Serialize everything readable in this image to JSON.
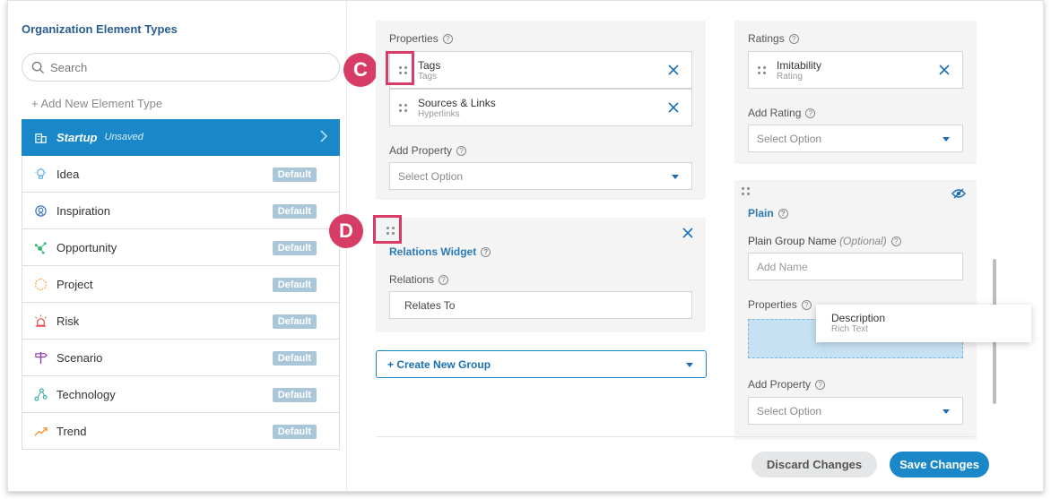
{
  "sidebar": {
    "title": "Organization Element Types",
    "search_placeholder": "Search",
    "add_label": "+ Add New Element Type",
    "active": {
      "label": "Startup",
      "status": "Unsaved"
    },
    "items": [
      {
        "label": "Idea",
        "badge": "Default",
        "icon": "lightbulb-icon",
        "color": "#5fb0e8"
      },
      {
        "label": "Inspiration",
        "badge": "Default",
        "icon": "inspiration-icon",
        "color": "#3a76c4"
      },
      {
        "label": "Opportunity",
        "badge": "Default",
        "icon": "opportunity-icon",
        "color": "#2eb86f"
      },
      {
        "label": "Project",
        "badge": "Default",
        "icon": "project-icon",
        "color": "#f2a33a"
      },
      {
        "label": "Risk",
        "badge": "Default",
        "icon": "alarm-icon",
        "color": "#e84848"
      },
      {
        "label": "Scenario",
        "badge": "Default",
        "icon": "signpost-icon",
        "color": "#8e3aa8"
      },
      {
        "label": "Technology",
        "badge": "Default",
        "icon": "network-icon",
        "color": "#28a8a0"
      },
      {
        "label": "Trend",
        "badge": "Default",
        "icon": "trend-icon",
        "color": "#f2902a"
      }
    ]
  },
  "callouts": {
    "c": "C",
    "d": "D"
  },
  "group1": {
    "properties_label": "Properties",
    "cards": [
      {
        "name": "Tags",
        "type": "Tags"
      },
      {
        "name": "Sources & Links",
        "type": "Hyperlinks"
      }
    ],
    "add_property_label": "Add Property",
    "select_placeholder": "Select Option"
  },
  "relations": {
    "title": "Relations Widget",
    "relations_label": "Relations",
    "value": "Relates To"
  },
  "create_group": "+ Create New Group",
  "ratings": {
    "label": "Ratings",
    "card": {
      "name": "Imitability",
      "type": "Rating"
    },
    "add_rating_label": "Add Rating",
    "select_placeholder": "Select Option"
  },
  "plain": {
    "title": "Plain",
    "group_name_label": "Plain Group Name",
    "optional": "(Optional)",
    "name_placeholder": "Add Name",
    "properties_label": "Properties",
    "add_property_label": "Add Property",
    "select_placeholder": "Select Option"
  },
  "drag_item": {
    "name": "Description",
    "type": "Rich Text"
  },
  "footer": {
    "discard": "Discard Changes",
    "save": "Save Changes"
  }
}
